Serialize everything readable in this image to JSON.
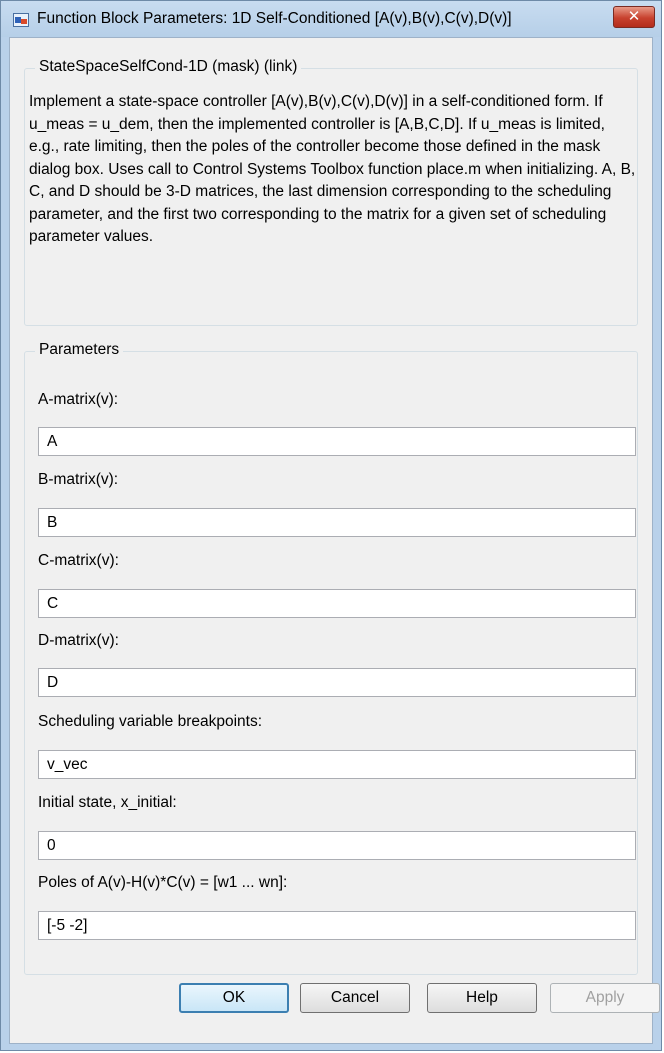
{
  "window": {
    "title": "Function Block Parameters: 1D Self-Conditioned [A(v),B(v),C(v),D(v)]",
    "close_label": "✕"
  },
  "description": {
    "group_title": "StateSpaceSelfCond-1D (mask) (link)",
    "text": "Implement a state-space controller [A(v),B(v),C(v),D(v)] in a self-conditioned form. If u_meas = u_dem, then the implemented controller is [A,B,C,D]. If u_meas is limited, e.g., rate limiting, then the poles of the controller become those defined in the mask dialog box. Uses call to Control Systems Toolbox function place.m when initializing. A, B, C, and D should be 3-D matrices, the last dimension corresponding to the scheduling parameter, and the first two corresponding to the matrix for a given set of scheduling parameter values."
  },
  "parameters": {
    "group_title": "Parameters",
    "fields": [
      {
        "label": "A-matrix(v):",
        "value": "A"
      },
      {
        "label": "B-matrix(v):",
        "value": "B"
      },
      {
        "label": "C-matrix(v):",
        "value": "C"
      },
      {
        "label": "D-matrix(v):",
        "value": "D"
      },
      {
        "label": "Scheduling variable breakpoints:",
        "value": "v_vec"
      },
      {
        "label": "Initial state, x_initial:",
        "value": "0"
      },
      {
        "label": "Poles of A(v)-H(v)*C(v) = [w1 ... wn]:",
        "value": "[-5 -2]"
      }
    ]
  },
  "buttons": {
    "ok": "OK",
    "cancel": "Cancel",
    "help": "Help",
    "apply": "Apply"
  },
  "colors": {
    "frame": "#b9d1ea",
    "client": "#f0f0f0",
    "close_button": "#c7412e",
    "default_button_border": "#3c7fb1"
  }
}
